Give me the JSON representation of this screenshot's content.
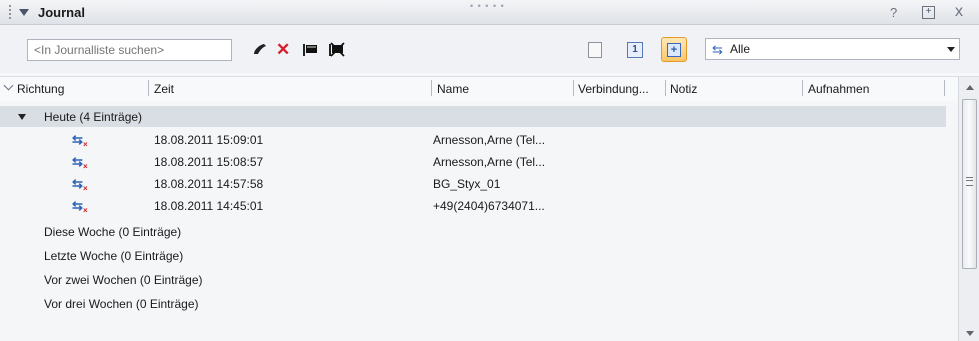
{
  "window": {
    "title": "Journal",
    "help_label": "?",
    "pin_label": "+",
    "close_label": "x",
    "top_dots": "• • • • •"
  },
  "toolbar": {
    "search_placeholder": "<In Journalliste suchen>",
    "delete_label": "✕",
    "calendar_label": "1",
    "active_view_label": "+",
    "filter_value": "Alle",
    "filter_icon_glyph": "⇆"
  },
  "columns": [
    {
      "label": "Richtung"
    },
    {
      "label": "Zeit"
    },
    {
      "label": "Name"
    },
    {
      "label": "Verbindung..."
    },
    {
      "label": "Notiz"
    },
    {
      "label": "Aufnahmen"
    }
  ],
  "groups": {
    "today": "Heute (4 Einträge)",
    "collapsed": [
      "Diese Woche (0 Einträge)",
      "Letzte Woche (0 Einträge)",
      "Vor zwei Wochen (0 Einträge)",
      "Vor drei Wochen (0 Einträge)"
    ]
  },
  "entries": [
    {
      "time": "18.08.2011 15:09:01",
      "name": "Arnesson,Arne (Tel..."
    },
    {
      "time": "18.08.2011 15:08:57",
      "name": "Arnesson,Arne (Tel..."
    },
    {
      "time": "18.08.2011 14:57:58",
      "name": "BG_Styx_01"
    },
    {
      "time": "18.08.2011 14:45:01",
      "name": "+49(2404)6734071..."
    }
  ],
  "icons": {
    "entry_direction": "missed-call-icon",
    "phone": "phone-icon",
    "flag": "flag-icon"
  }
}
